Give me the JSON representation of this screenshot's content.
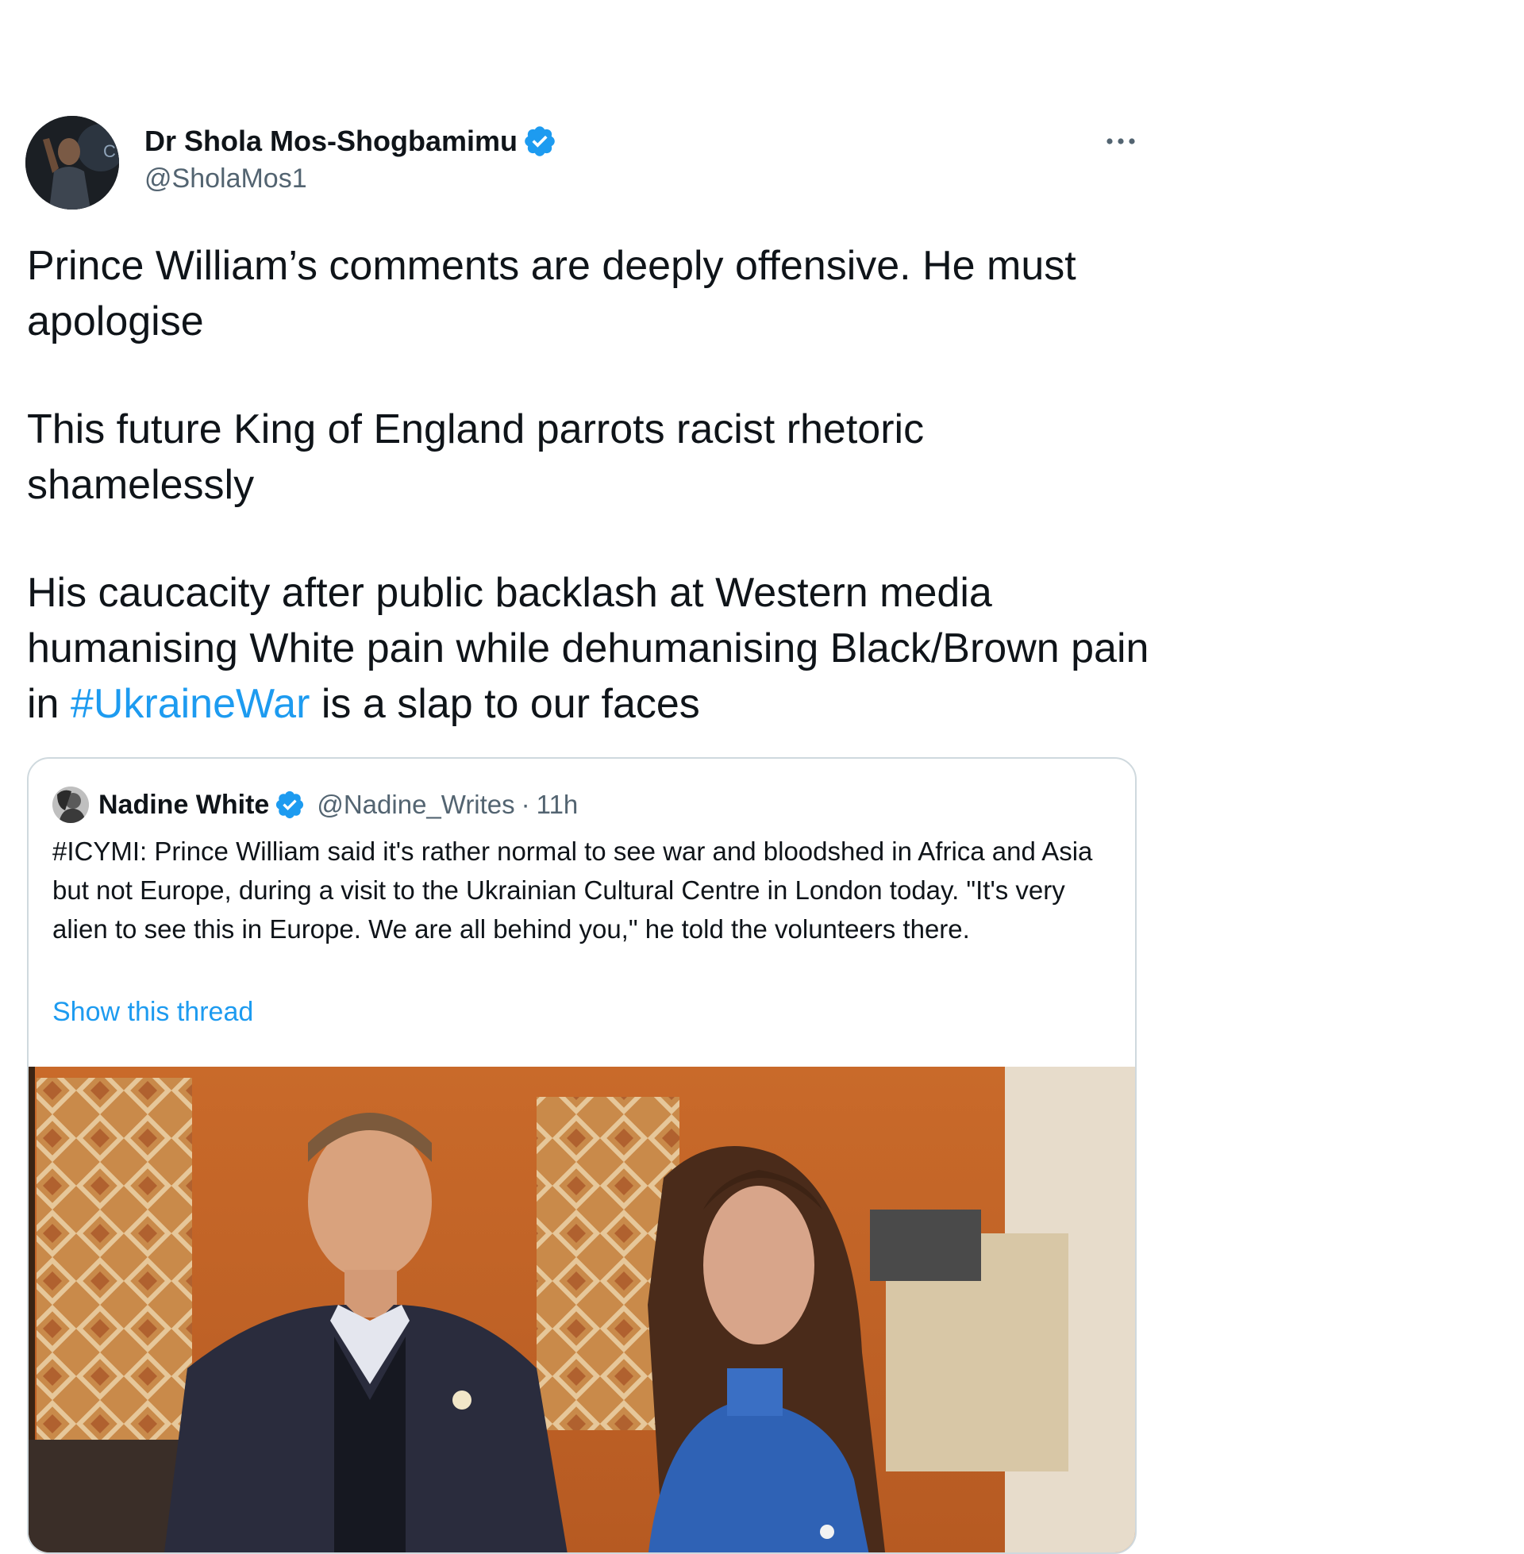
{
  "tweet": {
    "author": {
      "display_name": "Dr Shola Mos-Shogbamimu",
      "handle": "@SholaMos1",
      "verified_icon": "verified-badge-icon"
    },
    "more_icon": "more-options-icon",
    "paragraph1": "Prince William’s comments are deeply offensive. He must apologise",
    "paragraph2": "This future King of England parrots racist rhetoric shamelessly",
    "paragraph3_before": "His caucacity after public backlash at Western media humanising White pain while dehumanising Black/Brown pain in ",
    "paragraph3_hashtag": "#UkraineWar",
    "paragraph3_after": " is a slap to our faces"
  },
  "quoted_tweet": {
    "author": {
      "display_name": "Nadine White",
      "handle": "@Nadine_Writes",
      "separator": "·",
      "time": "11h"
    },
    "text": "#ICYMI: Prince William said it's rather normal to see war and bloodshed in Africa and Asia but not Europe, during a visit to the Ukrainian Cultural Centre in London today. \"It's very alien to see this in Europe. We are all behind you,\" he told the volunteers there.",
    "show_thread_label": "Show this thread",
    "image_subject": "photo-prince-william-and-kate"
  },
  "colors": {
    "link_blue": "#1d9bf0",
    "text_primary": "#0f1419",
    "text_secondary": "#536471",
    "border": "#cfd9de"
  }
}
